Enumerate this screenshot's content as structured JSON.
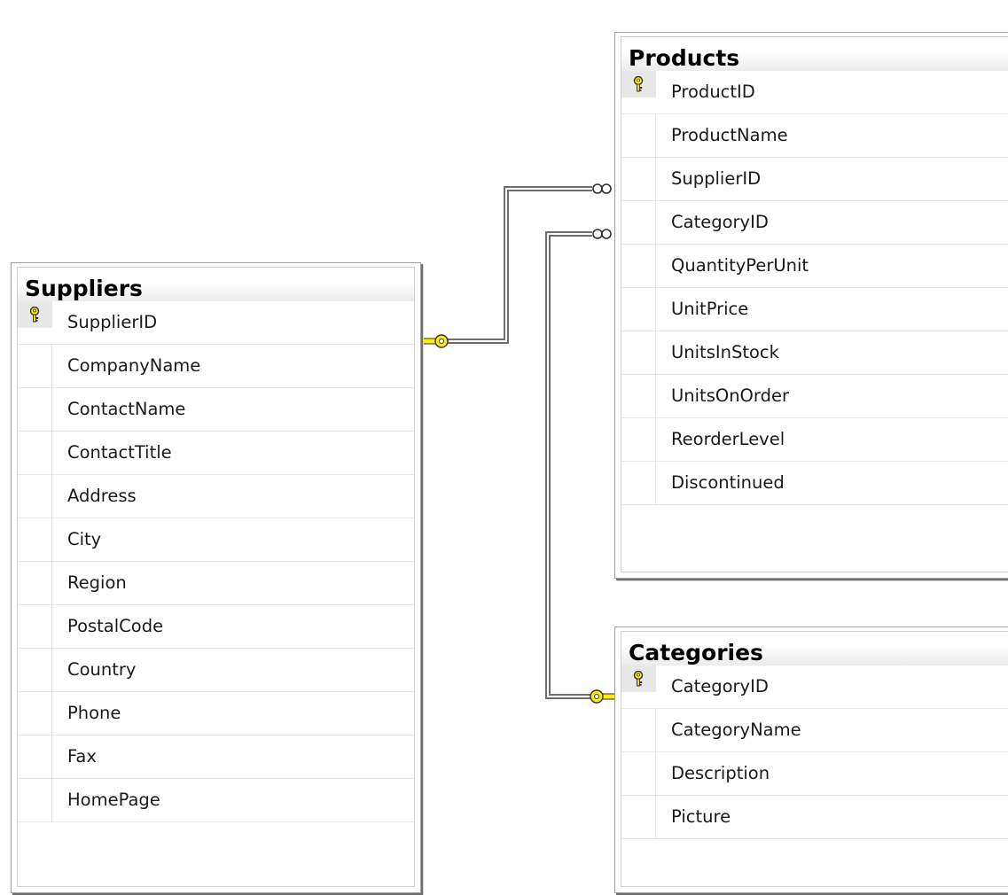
{
  "tables": {
    "products": {
      "title": "Products",
      "columns": [
        "ProductID",
        "ProductName",
        "SupplierID",
        "CategoryID",
        "QuantityPerUnit",
        "UnitPrice",
        "UnitsInStock",
        "UnitsOnOrder",
        "ReorderLevel",
        "Discontinued"
      ],
      "primary_key": "ProductID"
    },
    "suppliers": {
      "title": "Suppliers",
      "columns": [
        "SupplierID",
        "CompanyName",
        "ContactName",
        "ContactTitle",
        "Address",
        "City",
        "Region",
        "PostalCode",
        "Country",
        "Phone",
        "Fax",
        "HomePage"
      ],
      "primary_key": "SupplierID"
    },
    "categories": {
      "title": "Categories",
      "columns": [
        "CategoryID",
        "CategoryName",
        "Description",
        "Picture"
      ],
      "primary_key": "CategoryID"
    }
  },
  "relationships": [
    {
      "from": "suppliers.SupplierID",
      "to": "products.SupplierID",
      "one_end": "key-icon",
      "many_end": "infinity-icon"
    },
    {
      "from": "categories.CategoryID",
      "to": "products.CategoryID",
      "one_end": "key-icon",
      "many_end": "infinity-icon"
    }
  ],
  "colors": {
    "key": "#ffee00",
    "border": "#6e6e6e",
    "line": "#8c8c8c"
  }
}
